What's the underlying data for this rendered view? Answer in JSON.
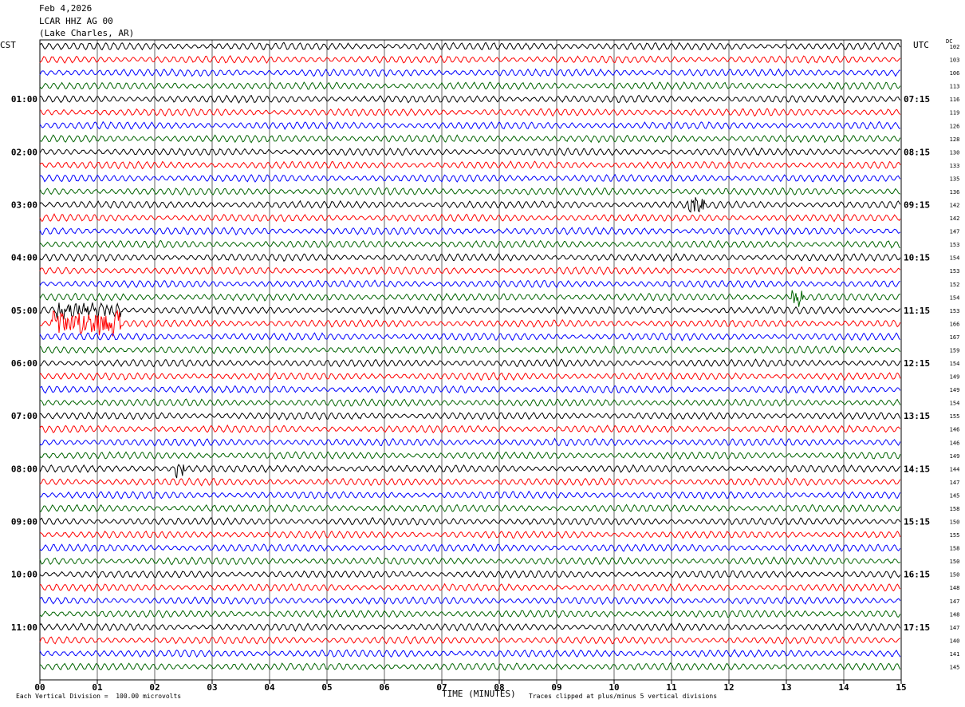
{
  "header": {
    "date": "Feb 4,2026",
    "station": "LCAR HHZ AG 00",
    "location": "(Lake Charles, AR)"
  },
  "left_axis_title": "CST",
  "right_axis_title": "UTC",
  "dc_title": "DC",
  "footer": {
    "scale_note": "Each Vertical Division =  100.00 microvolts",
    "clip_note": "Traces clipped at plus/minus 5 vertical divisions"
  },
  "chart_data": {
    "type": "line",
    "title": "LCAR HHZ AG 00",
    "xlabel": "TIME (MINUTES)",
    "xlim": [
      0,
      15
    ],
    "x_ticks": [
      "00",
      "01",
      "02",
      "03",
      "04",
      "05",
      "06",
      "07",
      "08",
      "09",
      "10",
      "11",
      "12",
      "13",
      "14",
      "15"
    ],
    "cst_labels": [
      "01:00",
      "02:00",
      "03:00",
      "04:00",
      "05:00",
      "06:00",
      "07:00",
      "08:00",
      "09:00",
      "10:00",
      "11:00"
    ],
    "utc_labels": [
      "07:15",
      "08:15",
      "09:15",
      "10:15",
      "11:15",
      "12:15",
      "13:15",
      "14:15",
      "15:15",
      "16:15",
      "17:15"
    ],
    "dc_offsets": [
      "102",
      "103",
      "106",
      "113",
      "116",
      "119",
      "126",
      "128",
      "130",
      "133",
      "135",
      "136",
      "142",
      "142",
      "147",
      "153",
      "154",
      "153",
      "152",
      "154",
      "153",
      "166",
      "167",
      "159",
      "154",
      "149",
      "149",
      "154",
      "155",
      "146",
      "146",
      "149",
      "144",
      "147",
      "145",
      "158",
      "150",
      "155",
      "158",
      "150",
      "150",
      "148",
      "147",
      "148",
      "147",
      "140",
      "141",
      "145"
    ],
    "trace_colors": [
      "#000000",
      "#ff0000",
      "#0000ff",
      "#006400"
    ],
    "trace_minutes": 15,
    "events": [
      {
        "row": 21,
        "minute_start": 0.2,
        "minute_end": 1.4,
        "amplitude": "clipped"
      },
      {
        "row": 20,
        "minute_start": 0.3,
        "minute_end": 1.4,
        "amplitude": "large"
      },
      {
        "row": 32,
        "minute_start": 2.35,
        "minute_end": 2.5,
        "amplitude": "spike"
      },
      {
        "row": 19,
        "minute_start": 13.1,
        "minute_end": 13.3,
        "amplitude": "spike"
      },
      {
        "row": 12,
        "minute_start": 11.3,
        "minute_end": 11.6,
        "amplitude": "spike"
      }
    ]
  }
}
